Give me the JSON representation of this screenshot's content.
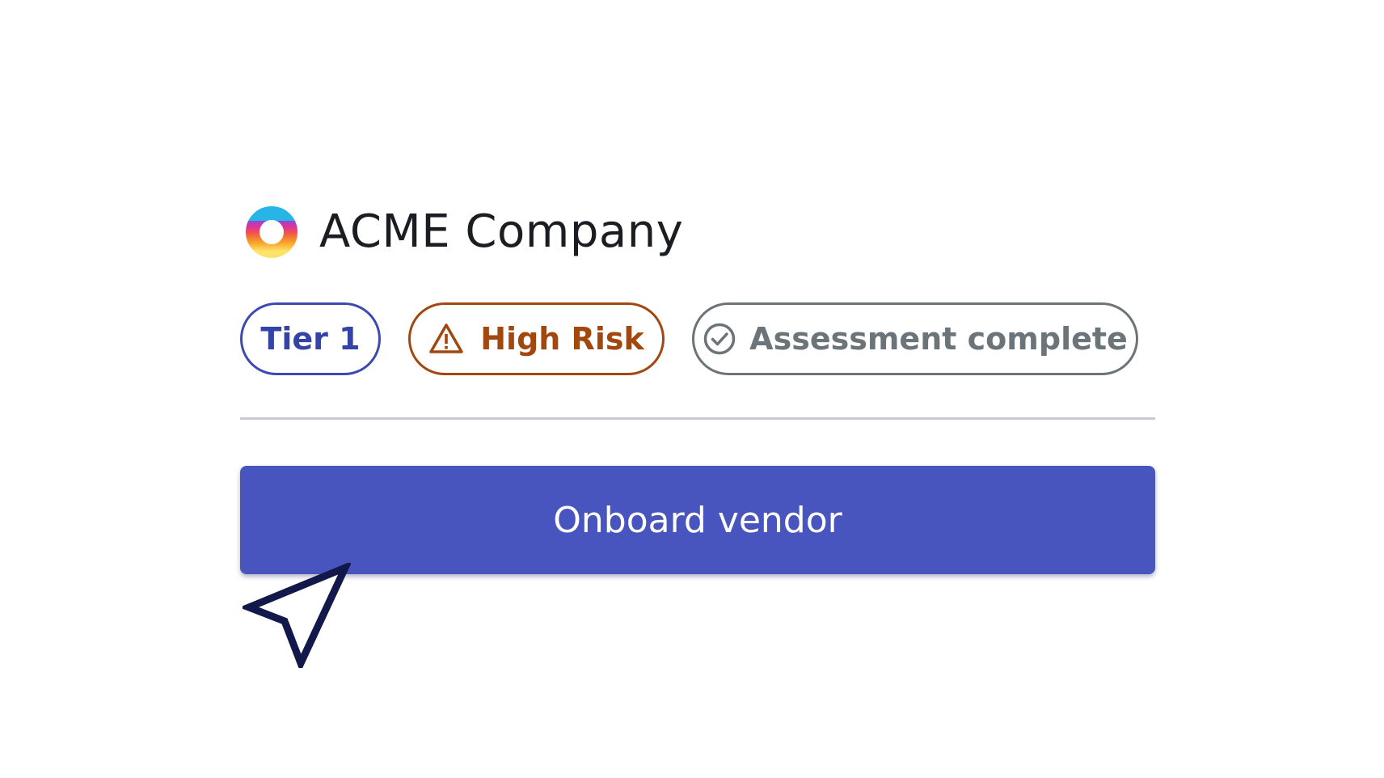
{
  "vendor": {
    "name": "ACME Company",
    "logo_icon": "acme-ring-logo"
  },
  "badges": {
    "tier": {
      "label": "Tier 1",
      "color": "#3443a6"
    },
    "risk": {
      "label": "High Risk",
      "icon": "warning-triangle-icon",
      "color": "#a2480f"
    },
    "assessment": {
      "label": "Assessment complete",
      "icon": "check-circle-icon",
      "color": "#6b7478"
    }
  },
  "actions": {
    "onboard_label": "Onboard vendor",
    "button_color": "#4855bf"
  },
  "cursor": {
    "icon": "pointer-arrow-icon",
    "color": "#12184a"
  }
}
